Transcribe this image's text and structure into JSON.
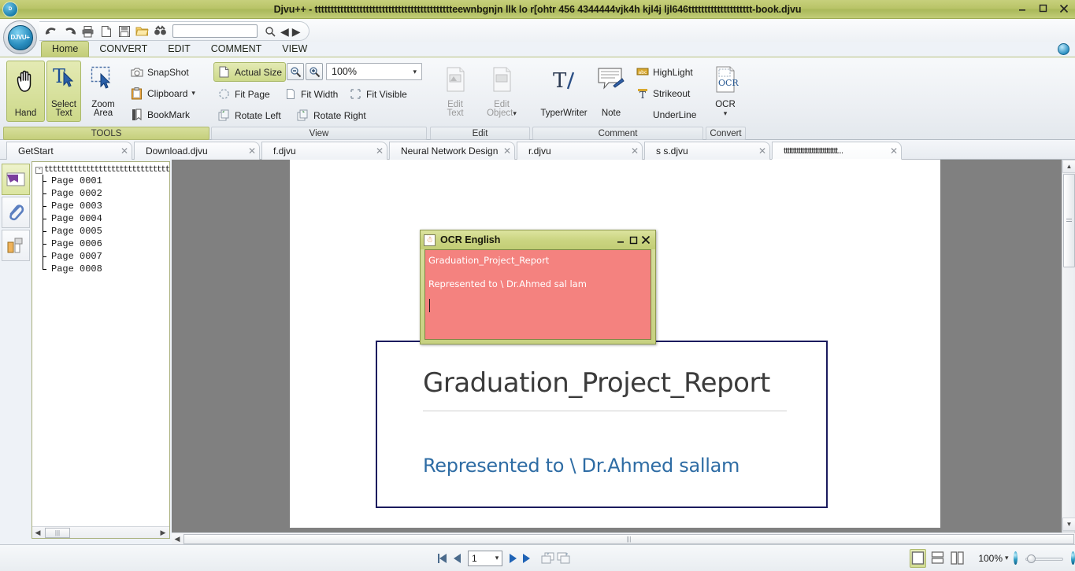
{
  "window": {
    "title": "Djvu++ - ttttttttttttttttttttttttttttttttttttttttttteewnbgnjn llk lo   r[ohtr 456 4344444vjk4h kjl4j ljl646tttttttttttttttttttt-book.djvu",
    "app_icon": "djvu-logo-icon",
    "minimize": "–",
    "maximize": "❐",
    "close": "✕"
  },
  "quick_access": {
    "buttons": [
      "undo-icon",
      "redo-icon",
      "print-icon",
      "new-icon",
      "save-icon",
      "open-icon",
      "find-icon"
    ],
    "search_value": "",
    "search_placeholder": "",
    "search_icon": "search-icon",
    "prev_label": "◀",
    "next_label": "▶"
  },
  "ribbon": {
    "tabs": [
      {
        "label": "Home",
        "active": true
      },
      {
        "label": "CONVERT",
        "active": false
      },
      {
        "label": "EDIT",
        "active": false
      },
      {
        "label": "COMMENT",
        "active": false
      },
      {
        "label": "VIEW",
        "active": false
      }
    ],
    "groups": {
      "tools": {
        "label": "TOOLS",
        "hand": "Hand",
        "select_text_line1": "Select",
        "select_text_line2": "Text",
        "zoom_area_line1": "Zoom",
        "zoom_area_line2": "Area",
        "snapshot": "SnapShot",
        "clipboard": "Clipboard",
        "bookmark": "BookMark"
      },
      "view": {
        "label": "View",
        "actual_size": "Actual Size",
        "zoom_value": "100%",
        "fit_page": "Fit Page",
        "fit_width": "Fit Width",
        "fit_visible": "Fit Visible",
        "rotate_left": "Rotate Left",
        "rotate_right": "Rotate Right"
      },
      "edit": {
        "label": "Edit",
        "edit_text_line1": "Edit",
        "edit_text_line2": "Text",
        "edit_object_line1": "Edit",
        "edit_object_line2": "Object"
      },
      "comment": {
        "label": "Comment",
        "typerwriter": "TyperWriter",
        "note": "Note",
        "highlight": "HighLight",
        "strikeout": "Strikeout",
        "underline": "UnderLine"
      },
      "convert": {
        "label": "Convert",
        "ocr": "OCR"
      }
    }
  },
  "doc_tabs": [
    {
      "label": "GetStart",
      "active": false
    },
    {
      "label": "Download.djvu",
      "active": false
    },
    {
      "label": "f.djvu",
      "active": false
    },
    {
      "label": "Neural Network Design ...",
      "active": false
    },
    {
      "label": "r.djvu",
      "active": false
    },
    {
      "label": "s s.djvu",
      "active": false
    },
    {
      "label": "ttttttttttttttttttttttttttttt...",
      "active": true
    }
  ],
  "side_panel_buttons": [
    {
      "name": "bookmarks-panel-icon",
      "active": true
    },
    {
      "name": "attachments-panel-icon",
      "active": false
    },
    {
      "name": "thumbnails-panel-icon",
      "active": false
    }
  ],
  "tree": {
    "root": "ttttttttttttttttttttttttttttttttttttttt",
    "expander": "-",
    "pages": [
      "Page  0001",
      "Page  0002",
      "Page  0003",
      "Page  0004",
      "Page  0005",
      "Page  0006",
      "Page  0007",
      "Page  0008"
    ]
  },
  "document": {
    "title": "Graduation_Project_Report",
    "subtitle": "Represented to \\ Dr.Ahmed sallam",
    "ghost_line": "",
    "title_color": "#3b3b3b",
    "subtitle_color": "#2e6ca4",
    "frame_color": "#1b1b5e"
  },
  "ocr_dialog": {
    "title": "OCR English",
    "icon": "java-coffee-icon",
    "minimize": "–",
    "maximize": "❐",
    "close": "✕",
    "line1": "Graduation_Project_Report",
    "line2": "",
    "line3": "Represented to \\ Dr.Ahmed sal lam",
    "bg_color": "#f4827f",
    "text_color": "#ffffff"
  },
  "status_bar": {
    "first_page": "◀|",
    "prev_page": "◀",
    "page_value": "1",
    "next_page": "▶",
    "last_page": "▶|",
    "single_page_view": "single-page-view-icon",
    "continuous_view": "continuous-view-icon",
    "facing_view": "facing-page-view-icon",
    "zoom_label": "100%",
    "zoom_caret": "˅",
    "zoom_out_icon": "zoom-out-globe-icon",
    "zoom_in_icon": "zoom-in-globe-icon"
  }
}
